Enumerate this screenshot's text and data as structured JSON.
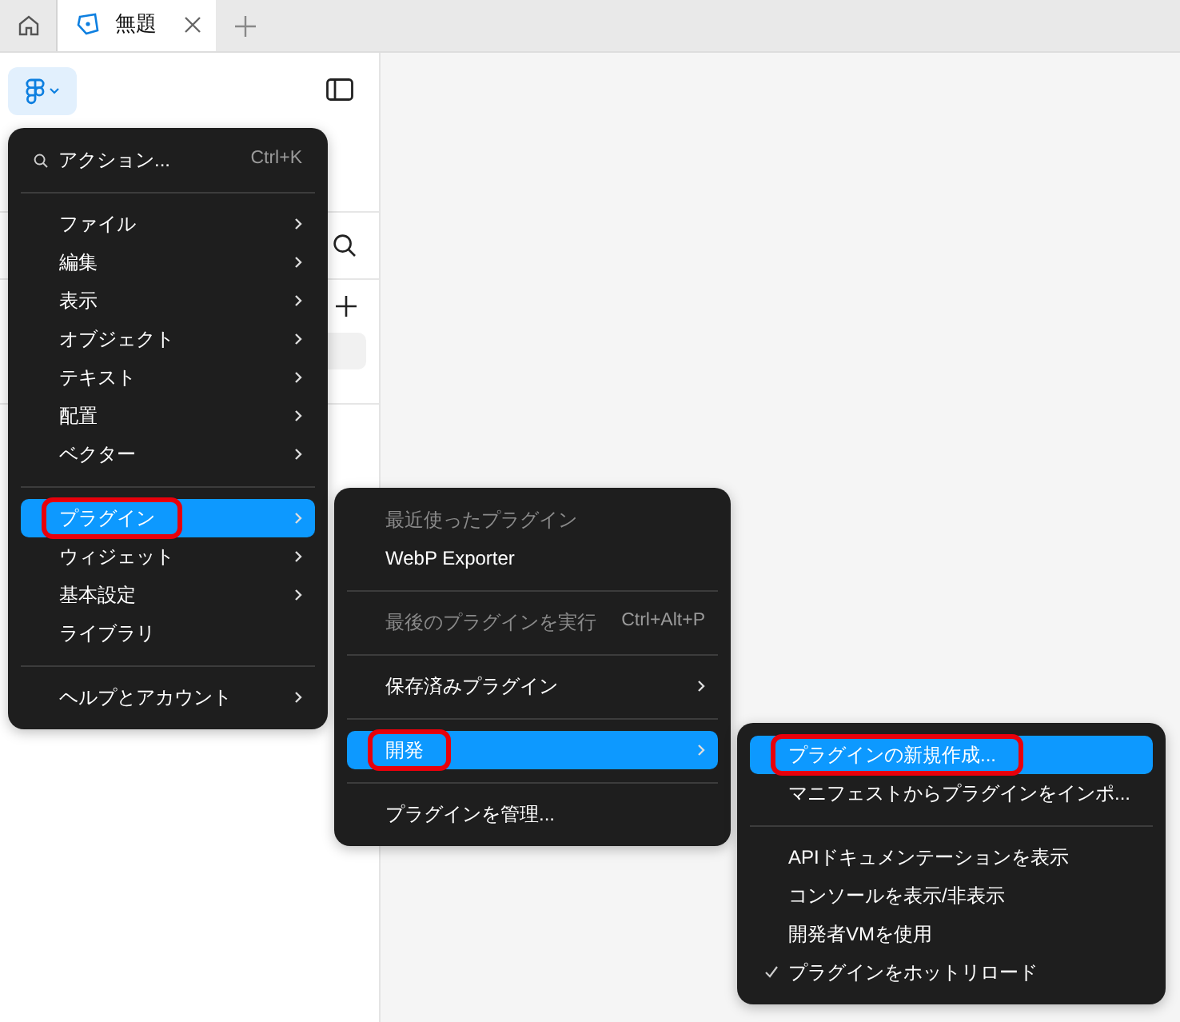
{
  "tabs": [
    {
      "label": "無題",
      "selected": true
    }
  ],
  "menus": [
    {
      "items": [
        {
          "kind": "action",
          "label": "アクション...",
          "shortcut": "Ctrl+K"
        },
        {
          "kind": "divider"
        },
        {
          "kind": "item",
          "label": "ファイル",
          "submenu": true,
          "selected": false,
          "annotated": false
        },
        {
          "kind": "item",
          "label": "編集",
          "submenu": true,
          "selected": false,
          "annotated": false
        },
        {
          "kind": "item",
          "label": "表示",
          "submenu": true,
          "selected": false,
          "annotated": false
        },
        {
          "kind": "item",
          "label": "オブジェクト",
          "submenu": true,
          "selected": false,
          "annotated": false
        },
        {
          "kind": "item",
          "label": "テキスト",
          "submenu": true,
          "selected": false,
          "annotated": false
        },
        {
          "kind": "item",
          "label": "配置",
          "submenu": true,
          "selected": false,
          "annotated": false
        },
        {
          "kind": "item",
          "label": "ベクター",
          "submenu": true,
          "selected": false,
          "annotated": false
        },
        {
          "kind": "divider"
        },
        {
          "kind": "item",
          "label": "プラグイン",
          "submenu": true,
          "selected": true,
          "annotated": true
        },
        {
          "kind": "item",
          "label": "ウィジェット",
          "submenu": true,
          "selected": false,
          "annotated": false
        },
        {
          "kind": "item",
          "label": "基本設定",
          "submenu": true,
          "selected": false,
          "annotated": false
        },
        {
          "kind": "item",
          "label": "ライブラリ",
          "submenu": false,
          "selected": false,
          "annotated": false
        },
        {
          "kind": "divider"
        },
        {
          "kind": "item",
          "label": "ヘルプとアカウント",
          "submenu": true,
          "selected": false,
          "annotated": false
        }
      ]
    },
    {
      "items": [
        {
          "kind": "heading",
          "label": "最近使ったプラグイン"
        },
        {
          "kind": "item",
          "label": "WebP Exporter",
          "submenu": false,
          "selected": false,
          "annotated": false
        },
        {
          "kind": "divider"
        },
        {
          "kind": "item",
          "label": "最後のプラグインを実行",
          "shortcut": "Ctrl+Alt+P",
          "disabled": true,
          "submenu": false,
          "selected": false,
          "annotated": false
        },
        {
          "kind": "divider"
        },
        {
          "kind": "item",
          "label": "保存済みプラグイン",
          "submenu": true,
          "selected": false,
          "annotated": false
        },
        {
          "kind": "divider"
        },
        {
          "kind": "item",
          "label": "開発",
          "submenu": true,
          "selected": true,
          "annotated": true
        },
        {
          "kind": "divider"
        },
        {
          "kind": "item",
          "label": "プラグインを管理...",
          "submenu": false,
          "selected": false,
          "annotated": false
        }
      ]
    },
    {
      "items": [
        {
          "kind": "item",
          "label": "プラグインの新規作成...",
          "submenu": false,
          "selected": true,
          "annotated": true
        },
        {
          "kind": "item",
          "label": "マニフェストからプラグインをインポ...",
          "submenu": false,
          "selected": false,
          "annotated": false
        },
        {
          "kind": "divider"
        },
        {
          "kind": "item",
          "label": "APIドキュメンテーションを表示",
          "submenu": false,
          "selected": false,
          "annotated": false
        },
        {
          "kind": "item",
          "label": "コンソールを表示/非表示",
          "submenu": false,
          "selected": false,
          "annotated": false
        },
        {
          "kind": "item",
          "label": "開発者VMを使用",
          "submenu": false,
          "selected": false,
          "annotated": false
        },
        {
          "kind": "item",
          "label": "プラグインをホットリロード",
          "submenu": false,
          "selected": false,
          "annotated": false,
          "checked": true
        }
      ]
    }
  ]
}
